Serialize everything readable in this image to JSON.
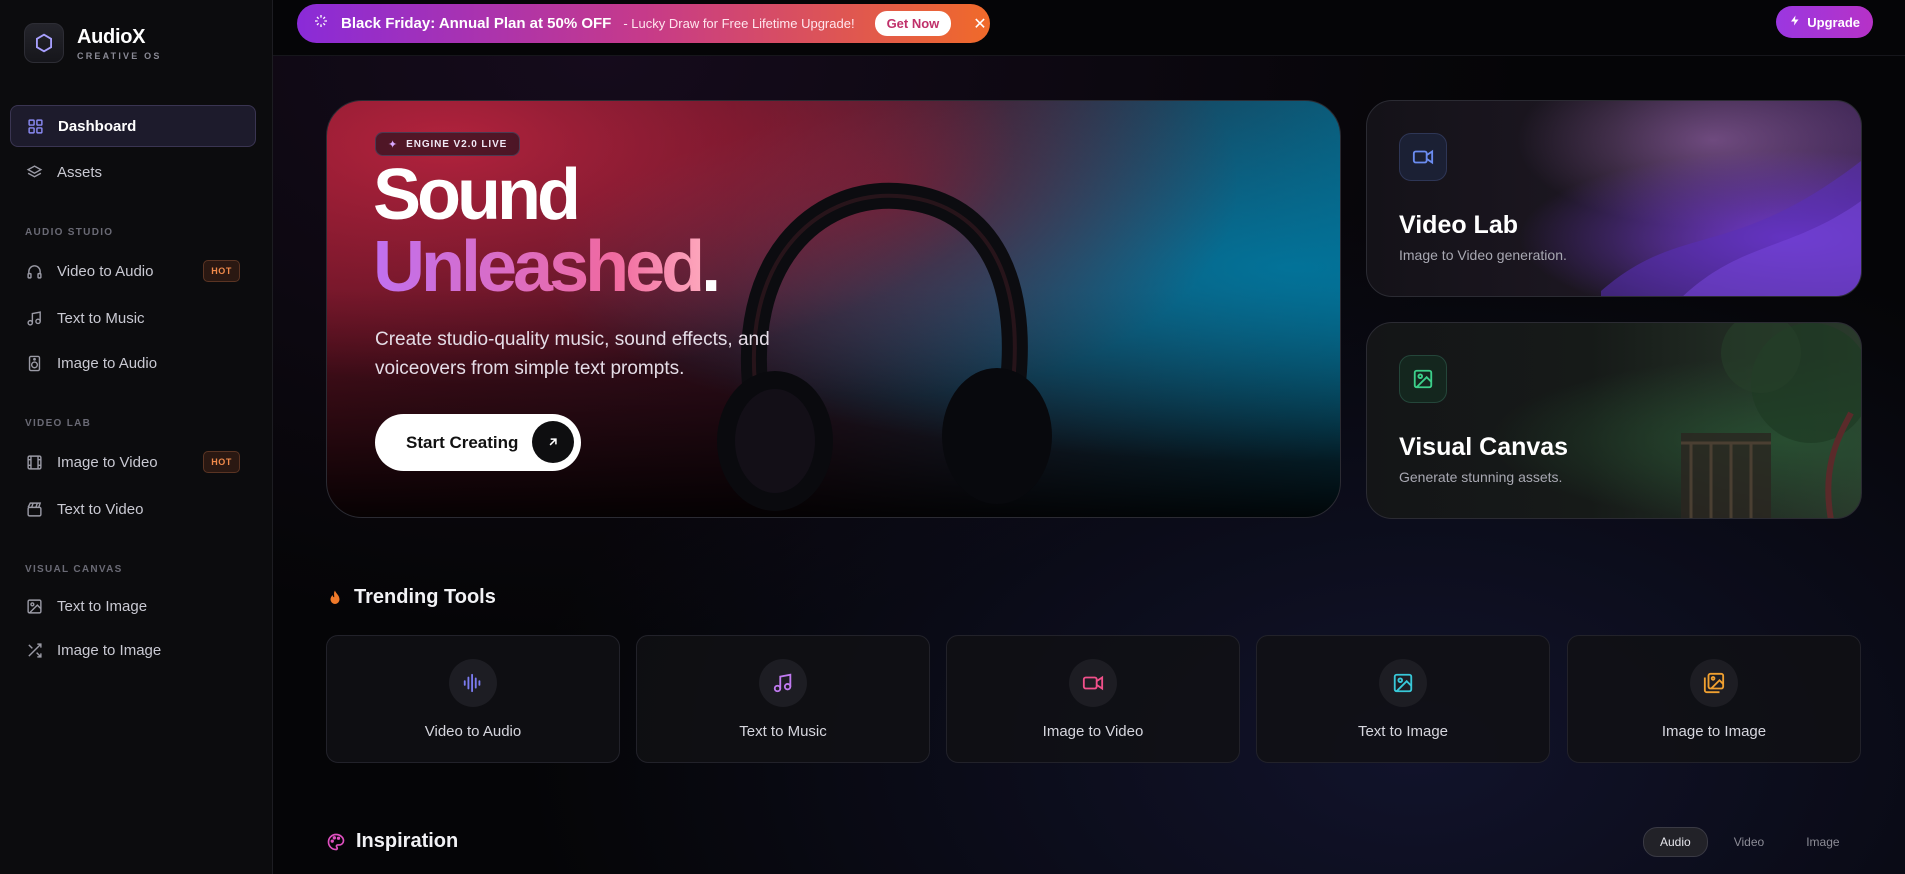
{
  "brand": {
    "name": "AudioX",
    "subtitle": "CREATIVE OS"
  },
  "sidebar": {
    "items": [
      {
        "label": "Dashboard",
        "icon": "grid-icon",
        "active": true
      },
      {
        "label": "Assets",
        "icon": "layers-icon"
      }
    ],
    "sections": [
      {
        "title": "AUDIO STUDIO",
        "items": [
          {
            "label": "Video to Audio",
            "icon": "headphones-icon",
            "badge": "HOT"
          },
          {
            "label": "Text to Music",
            "icon": "music-note-icon"
          },
          {
            "label": "Image to Audio",
            "icon": "speaker-icon"
          }
        ]
      },
      {
        "title": "VIDEO LAB",
        "items": [
          {
            "label": "Image to Video",
            "icon": "film-icon",
            "badge": "HOT"
          },
          {
            "label": "Text to Video",
            "icon": "clapperboard-icon"
          }
        ]
      },
      {
        "title": "VISUAL CANVAS",
        "items": [
          {
            "label": "Text to Image",
            "icon": "image-icon"
          },
          {
            "label": "Image to Image",
            "icon": "shuffle-icon"
          }
        ]
      }
    ]
  },
  "promo": {
    "title": "Black Friday: Annual Plan at 50% OFF",
    "subtitle": "- Lucky Draw for Free Lifetime Upgrade!",
    "button": "Get Now",
    "close": "✕"
  },
  "header": {
    "upgrade": "Upgrade"
  },
  "hero": {
    "chip": "ENGINE V2.0 LIVE",
    "line1": "Sound",
    "line2": "Unleashed",
    "line2_end": ".",
    "description": "Create studio-quality music, sound effects, and voiceovers from simple text prompts.",
    "cta": "Start Creating"
  },
  "cards": [
    {
      "title": "Video Lab",
      "subtitle": "Image to Video generation."
    },
    {
      "title": "Visual Canvas",
      "subtitle": "Generate stunning assets."
    }
  ],
  "trending": {
    "title": "Trending Tools",
    "tools": [
      {
        "label": "Video to Audio",
        "icon": "waveform-icon",
        "color": "#7b7bf0"
      },
      {
        "label": "Text to Music",
        "icon": "music-note-icon",
        "color": "#c07af0"
      },
      {
        "label": "Image to Video",
        "icon": "video-camera-icon",
        "color": "#f0508a"
      },
      {
        "label": "Text to Image",
        "icon": "image-icon",
        "color": "#38c8d8"
      },
      {
        "label": "Image to Image",
        "icon": "images-icon",
        "color": "#f0a030"
      }
    ]
  },
  "inspiration": {
    "title": "Inspiration",
    "tabs": [
      "Audio",
      "Video",
      "Image"
    ],
    "active_tab": "Audio"
  },
  "colors": {
    "accent": "#9b37e0",
    "hot": "#f08a4b",
    "background": "#050507"
  }
}
